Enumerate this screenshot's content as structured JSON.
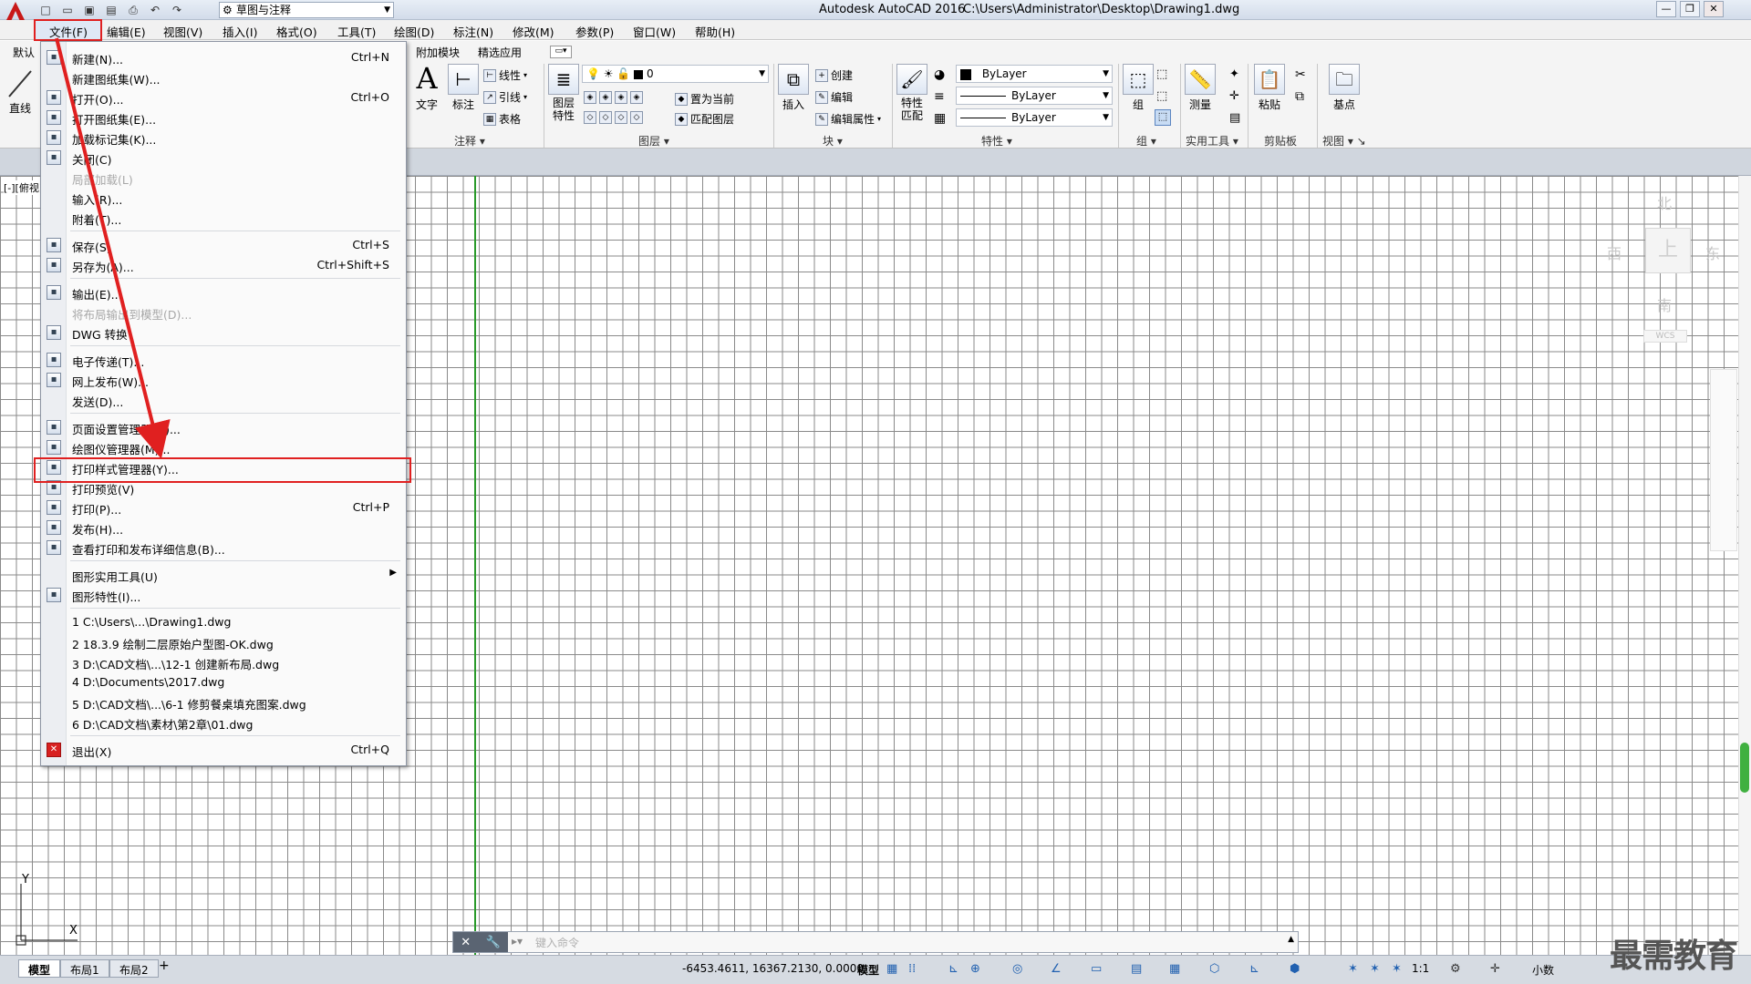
{
  "titlebar": {
    "app_title": "Autodesk AutoCAD 2016",
    "file_path": "C:\\Users\\Administrator\\Desktop\\Drawing1.dwg",
    "workspace": "草图与注释",
    "app_logo": "A"
  },
  "menubar": [
    "文件(F)",
    "编辑(E)",
    "视图(V)",
    "插入(I)",
    "格式(O)",
    "工具(T)",
    "绘图(D)",
    "标注(N)",
    "修改(M)",
    "参数(P)",
    "窗口(W)",
    "帮助(H)"
  ],
  "ribbon": {
    "tabs": [
      "默认",
      "附加模块",
      "精选应用"
    ],
    "left_tool": "直线",
    "annotation": {
      "text": "文字",
      "dim": "标注",
      "linear": "线性",
      "leader": "引线",
      "table": "表格",
      "label": "注释"
    },
    "layers": {
      "props": "图层\n特性",
      "current_layer": "0",
      "set_current": "置为当前",
      "match": "匹配图层",
      "label": "图层"
    },
    "block": {
      "insert": "插入",
      "create": "创建",
      "edit": "编辑",
      "edit_attr": "编辑属性",
      "label": "块"
    },
    "properties": {
      "match": "特性\n匹配",
      "color": "ByLayer",
      "linetype": "ByLayer",
      "lineweight": "ByLayer",
      "label": "特性"
    },
    "groups": {
      "group": "组",
      "label": "组"
    },
    "utilities": {
      "measure": "测量",
      "label": "实用工具"
    },
    "clipboard": {
      "paste": "粘贴",
      "label": "剪贴板"
    },
    "view": {
      "base": "基点",
      "label": "视图"
    }
  },
  "viewport_label": "[-][俯视]",
  "file_menu": {
    "items": [
      {
        "label": "新建(N)...",
        "shortcut": "Ctrl+N",
        "icon": "new-icon"
      },
      {
        "label": "新建图纸集(W)...",
        "shortcut": "",
        "icon": ""
      },
      {
        "label": "打开(O)...",
        "shortcut": "Ctrl+O",
        "icon": "open-icon"
      },
      {
        "label": "打开图纸集(E)...",
        "shortcut": "",
        "icon": "open-sheetset-icon"
      },
      {
        "label": "加载标记集(K)...",
        "shortcut": "",
        "icon": "markup-icon"
      },
      {
        "label": "关闭(C)",
        "shortcut": "",
        "icon": "close-icon"
      },
      {
        "label": "局部加载(L)",
        "shortcut": "",
        "icon": "",
        "disabled": true
      },
      {
        "label": "输入(R)...",
        "shortcut": "",
        "icon": ""
      },
      {
        "label": "附着(T)...",
        "shortcut": "",
        "icon": ""
      },
      {
        "label": "保存(S)",
        "shortcut": "Ctrl+S",
        "icon": "save-icon"
      },
      {
        "label": "另存为(A)...",
        "shortcut": "Ctrl+Shift+S",
        "icon": "saveas-icon"
      },
      {
        "label": "输出(E)...",
        "shortcut": "",
        "icon": "export-icon"
      },
      {
        "label": "将布局输出到模型(D)...",
        "shortcut": "",
        "icon": "",
        "disabled": true
      },
      {
        "label": "DWG 转换",
        "shortcut": "",
        "icon": "dwg-convert-icon"
      },
      {
        "label": "电子传递(T)...",
        "shortcut": "",
        "icon": "etransmit-icon"
      },
      {
        "label": "网上发布(W)...",
        "shortcut": "",
        "icon": "publish-web-icon"
      },
      {
        "label": "发送(D)...",
        "shortcut": "",
        "icon": ""
      },
      {
        "label": "页面设置管理器(G)...",
        "shortcut": "",
        "icon": "page-setup-icon"
      },
      {
        "label": "绘图仪管理器(M)...",
        "shortcut": "",
        "icon": "plotter-icon"
      },
      {
        "label": "打印样式管理器(Y)...",
        "shortcut": "",
        "icon": "plot-style-icon"
      },
      {
        "label": "打印预览(V)",
        "shortcut": "",
        "icon": "preview-icon"
      },
      {
        "label": "打印(P)...",
        "shortcut": "Ctrl+P",
        "icon": "print-icon"
      },
      {
        "label": "发布(H)...",
        "shortcut": "",
        "icon": "publish-icon"
      },
      {
        "label": "查看打印和发布详细信息(B)...",
        "shortcut": "",
        "icon": "details-icon"
      },
      {
        "label": "图形实用工具(U)",
        "shortcut": "",
        "icon": "",
        "submenu": true
      },
      {
        "label": "图形特性(I)...",
        "shortcut": "",
        "icon": "drawing-props-icon"
      },
      {
        "label": "1 C:\\Users\\...\\Drawing1.dwg",
        "shortcut": "",
        "icon": ""
      },
      {
        "label": "2 18.3.9 绘制二层原始户型图-OK.dwg",
        "shortcut": "",
        "icon": ""
      },
      {
        "label": "3 D:\\CAD文档\\...\\12-1 创建新布局.dwg",
        "shortcut": "",
        "icon": ""
      },
      {
        "label": "4 D:\\Documents\\2017.dwg",
        "shortcut": "",
        "icon": ""
      },
      {
        "label": "5 D:\\CAD文档\\...\\6-1 修剪餐桌填充图案.dwg",
        "shortcut": "",
        "icon": ""
      },
      {
        "label": "6 D:\\CAD文档\\素材\\第2章\\01.dwg",
        "shortcut": "",
        "icon": ""
      },
      {
        "label": "退出(X)",
        "shortcut": "Ctrl+Q",
        "icon": "exit-icon"
      }
    ]
  },
  "viewcube": {
    "north": "北",
    "south": "南",
    "east": "东",
    "west": "西",
    "face": "上",
    "wcs": "WCS"
  },
  "ucs": {
    "x": "X",
    "y": "Y"
  },
  "command_line": {
    "placeholder": "键入命令"
  },
  "layout_tabs": [
    "模型",
    "布局1",
    "布局2"
  ],
  "status": {
    "coords": "-6453.4611, 16367.2130, 0.0000",
    "model": "模型",
    "scale": "1:1",
    "units": "小数"
  },
  "watermark": "最需教育"
}
